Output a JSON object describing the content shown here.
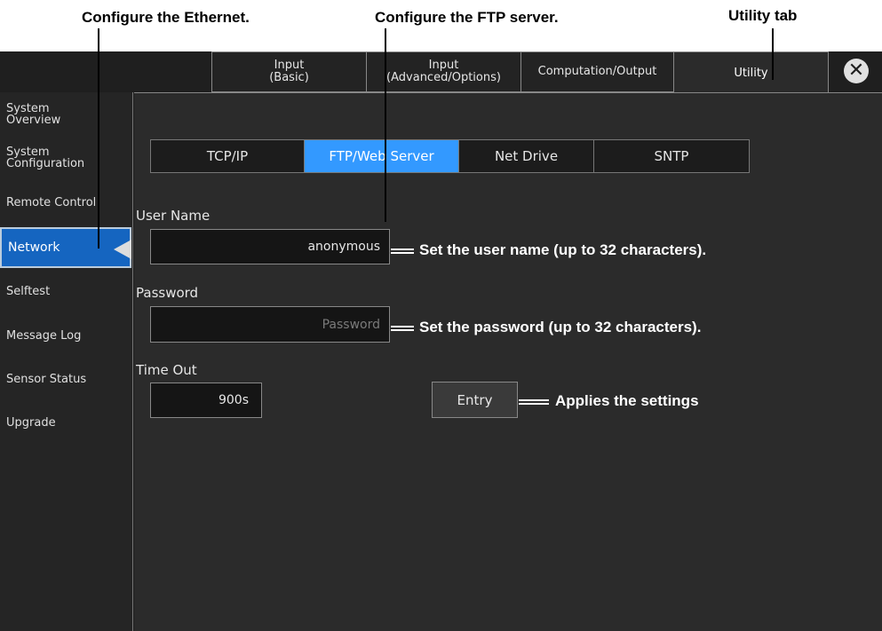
{
  "callouts": {
    "ethernet": "Configure the Ethernet.",
    "ftp": "Configure the FTP server.",
    "utility_tab": "Utility tab",
    "user_name_note": "Set the user name (up to 32 characters).",
    "password_note": "Set the password (up to 32 characters).",
    "entry_note": "Applies the settings"
  },
  "tabs": [
    {
      "label": "Input\n(Basic)"
    },
    {
      "label": "Input\n(Advanced/Options)"
    },
    {
      "label": "Computation/Output"
    },
    {
      "label": "Utility",
      "active": true
    }
  ],
  "close_icon": "close-icon",
  "sidebar": {
    "items": [
      {
        "label": "System\nOverview"
      },
      {
        "label": "System\nConfiguration"
      },
      {
        "label": "Remote Control"
      },
      {
        "label": "Network",
        "active": true
      },
      {
        "label": "Selftest"
      },
      {
        "label": "Message Log"
      },
      {
        "label": "Sensor Status"
      },
      {
        "label": "Upgrade"
      }
    ]
  },
  "subtabs": [
    {
      "label": "TCP/IP"
    },
    {
      "label": "FTP/Web Server",
      "active": true
    },
    {
      "label": "Net Drive"
    },
    {
      "label": "SNTP"
    }
  ],
  "form": {
    "user_name_label": "User Name",
    "user_name_value": "anonymous",
    "password_label": "Password",
    "password_placeholder": "Password",
    "timeout_label": "Time Out",
    "timeout_value": "900s",
    "entry_label": "Entry"
  },
  "colors": {
    "accent": "#3399ff",
    "sidebar_active": "#1565c0",
    "background": "#2b2b2b"
  }
}
